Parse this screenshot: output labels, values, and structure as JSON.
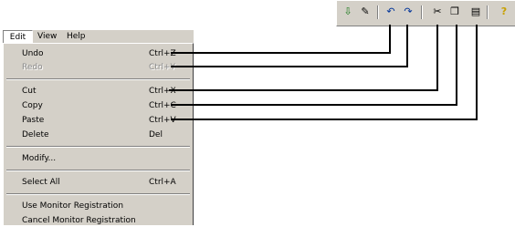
{
  "menubar": {
    "edit": "Edit",
    "view": "View",
    "help": "Help"
  },
  "menu": {
    "items": [
      {
        "label": "Undo",
        "shortcut": "Ctrl+Z",
        "enabled": true
      },
      {
        "label": "Redo",
        "shortcut": "Ctrl+Y",
        "enabled": false
      },
      {
        "label": "Cut",
        "shortcut": "Ctrl+X",
        "enabled": true
      },
      {
        "label": "Copy",
        "shortcut": "Ctrl+C",
        "enabled": true
      },
      {
        "label": "Paste",
        "shortcut": "Ctrl+V",
        "enabled": true
      },
      {
        "label": "Delete",
        "shortcut": "Del",
        "enabled": true
      },
      {
        "label": "Modify...",
        "shortcut": "",
        "enabled": true
      },
      {
        "label": "Select All",
        "shortcut": "Ctrl+A",
        "enabled": true
      },
      {
        "label": "Use Monitor Registration",
        "shortcut": "",
        "enabled": true
      },
      {
        "label": "Cancel Monitor Registration",
        "shortcut": "",
        "enabled": true
      }
    ]
  },
  "toolbar": {
    "buttons": [
      {
        "icon": "save-to-device-icon",
        "glyph": "⇩"
      },
      {
        "icon": "edit-icon",
        "glyph": "✎"
      },
      {
        "icon": "undo-icon",
        "glyph": "↶"
      },
      {
        "icon": "redo-icon",
        "glyph": "↷"
      },
      {
        "icon": "cut-icon",
        "glyph": "✂"
      },
      {
        "icon": "copy-icon",
        "glyph": "❐"
      },
      {
        "icon": "paste-icon",
        "glyph": "▤"
      },
      {
        "icon": "help-icon",
        "glyph": "?"
      }
    ]
  },
  "colors": {
    "menu_bg": "#d4d0c8",
    "help_icon": "#c8a000",
    "leader": "#000000"
  }
}
